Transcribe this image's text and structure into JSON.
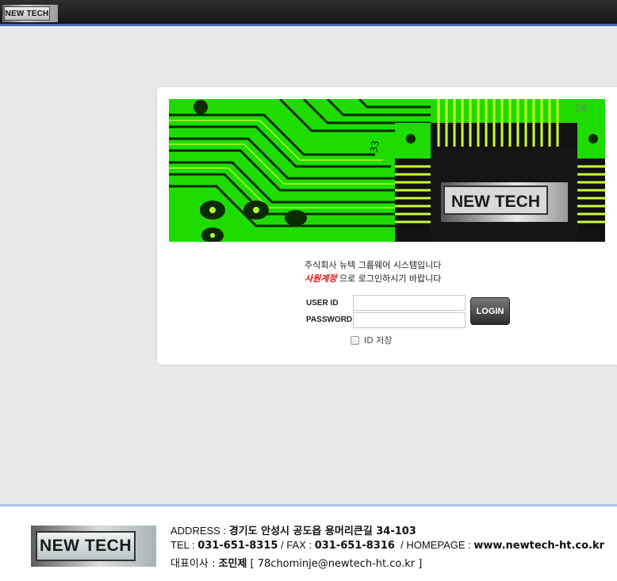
{
  "header": {
    "logo_text": "NEW TECH"
  },
  "banner": {
    "logo_text": "NEW TECH",
    "pin_labels": [
      "33",
      "28"
    ]
  },
  "login": {
    "message_line1": "주식회사 뉴텍 그룹웨어 시스템입니다",
    "message_account": "사원계정",
    "message_line2_rest": " 으로 로그인하시기 바랍니다",
    "user_id_label": "USER ID",
    "password_label": "PASSWORD",
    "user_id_value": "",
    "password_value": "",
    "login_button": "LOGIN",
    "save_id_label": "ID 저장"
  },
  "footer": {
    "logo_text": "NEW TECH",
    "address_label": "ADDRESS : ",
    "address_value": "경기도 안성시 공도읍 용머리큰길 34-103",
    "tel_label": "TEL : ",
    "tel_value": "031-651-8315",
    "fax_label": " / FAX : ",
    "fax_value": "031-651-8316",
    "homepage_label": "  / HOMEPAGE : ",
    "homepage_value": "www.newtech-ht.co.kr",
    "ceo_label": "대표이사 : ",
    "ceo_value": "조민제",
    "email_text": " [ 78chominje@newtech-ht.co.kr ]"
  },
  "colors": {
    "accent_blue": "#3f6fb4",
    "footer_border": "#a9c6e8",
    "pcb_green": "#22e000",
    "account_red": "#dd1111"
  }
}
